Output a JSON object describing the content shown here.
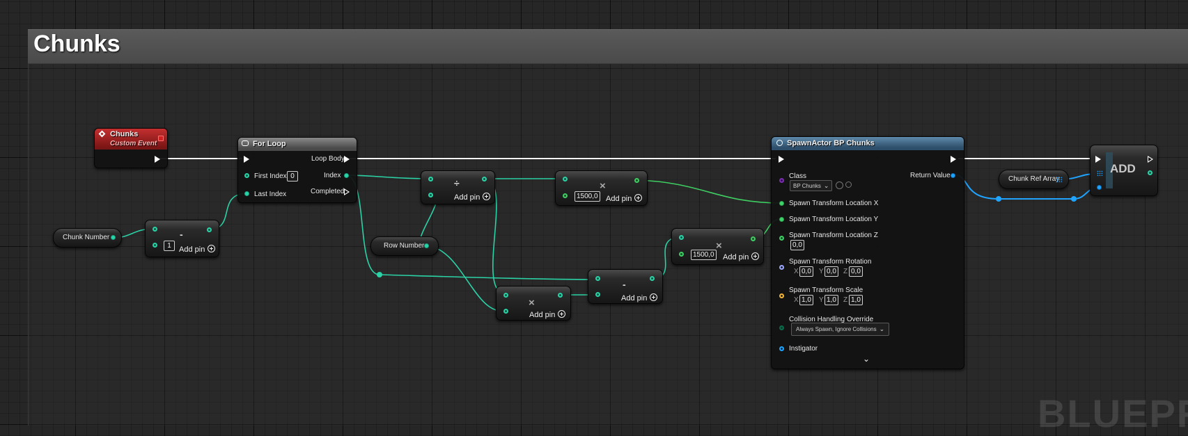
{
  "comment": {
    "title": "Chunks"
  },
  "watermark": "BLUEPRI",
  "event_node": {
    "title": "Chunks",
    "subtitle": "Custom Event"
  },
  "for_loop": {
    "title": "For Loop",
    "loop_body": "Loop Body",
    "first_index": "First Index",
    "first_index_value": "0",
    "index": "Index",
    "last_index": "Last Index",
    "completed": "Completed"
  },
  "chunk_number": {
    "label": "Chunk Number"
  },
  "row_number": {
    "label": "Row Number"
  },
  "chunk_ref_array": {
    "label": "Chunk Ref Array"
  },
  "subtract_a": {
    "op": "-",
    "value": "1",
    "add_pin": "Add pin"
  },
  "divide_node": {
    "op": "÷",
    "add_pin": "Add pin"
  },
  "multiply_top": {
    "op": "×",
    "value": "1500,0",
    "add_pin": "Add pin"
  },
  "multiply_bottom": {
    "op": "×",
    "add_pin": "Add pin"
  },
  "subtract_b": {
    "op": "-",
    "add_pin": "Add pin"
  },
  "multiply_right": {
    "op": "×",
    "value": "1500,0",
    "add_pin": "Add pin"
  },
  "spawn_actor": {
    "title": "SpawnActor BP Chunks",
    "class_label": "Class",
    "class_value": "BP Chunks",
    "return_value": "Return Value",
    "loc_x": "Spawn Transform Location X",
    "loc_y": "Spawn Transform Location Y",
    "loc_z": "Spawn Transform Location Z",
    "loc_z_value": "0,0",
    "rotation": "Spawn Transform Rotation",
    "rot_x": "0,0",
    "rot_y": "0,0",
    "rot_z": "0,0",
    "scale": "Spawn Transform Scale",
    "scale_x": "1,0",
    "scale_y": "1,0",
    "scale_z": "1,0",
    "axis_x": "X",
    "axis_y": "Y",
    "axis_z": "Z",
    "collision": "Collision Handling Override",
    "collision_value": "Always Spawn, Ignore Collisions",
    "instigator": "Instigator"
  },
  "add_node": {
    "label": "ADD"
  },
  "colors": {
    "exec": "#ffffff",
    "integer": "#2bd2a6",
    "float": "#3fce62",
    "object": "#1fa4ff",
    "event_header": "#a82020",
    "spawn_header": "#3e6a8a"
  }
}
